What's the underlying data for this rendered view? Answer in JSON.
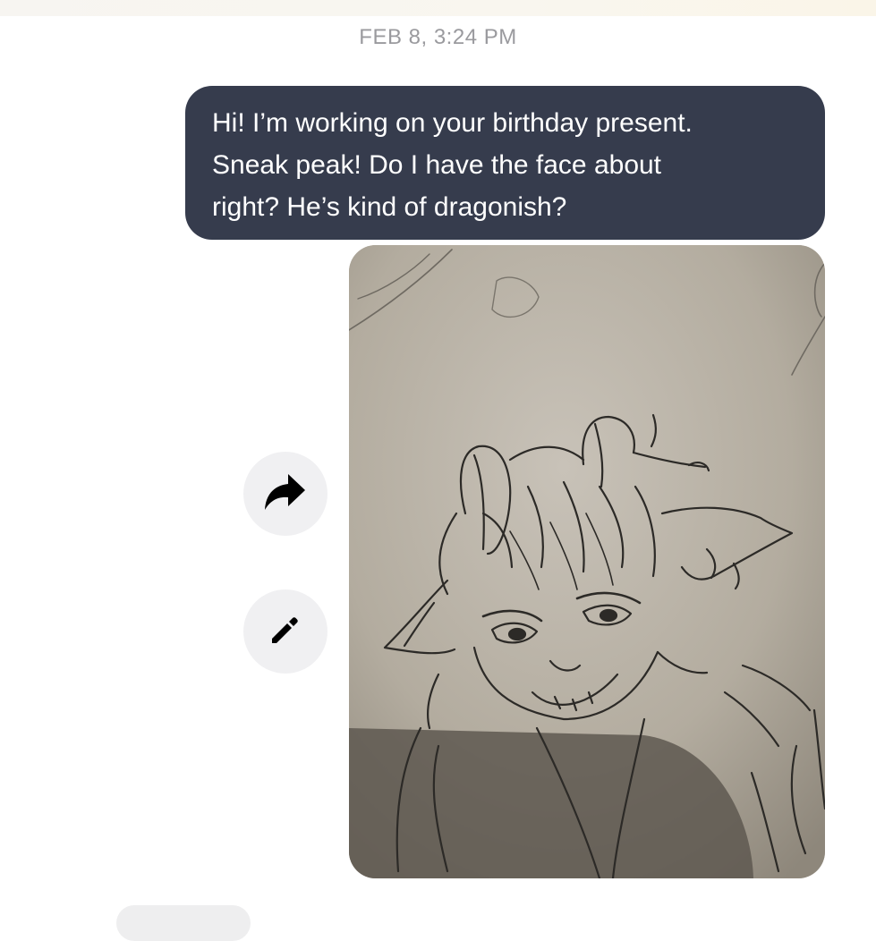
{
  "conversation": {
    "timestamp": "FEB 8, 3:24 PM",
    "message": {
      "text": "Hi! I’m working on your birthday present. Sneak peak! Do I have the face about right? He’s kind of dragonish?",
      "lines": [
        "Hi! I’m working on your birthday present.",
        "Sneak peak! Do I have the face about",
        "right? He’s kind of dragonish?"
      ]
    },
    "attachment": {
      "kind": "photo",
      "subject": "pencil-sketch"
    }
  },
  "actions": {
    "share_icon": "share-arrow-icon",
    "edit_icon": "pencil-icon"
  },
  "colors": {
    "bubble_background": "#363c4d",
    "bubble_text": "#ffffff",
    "timestamp_text": "#9a9a9e",
    "action_background": "#f0f0f2"
  }
}
